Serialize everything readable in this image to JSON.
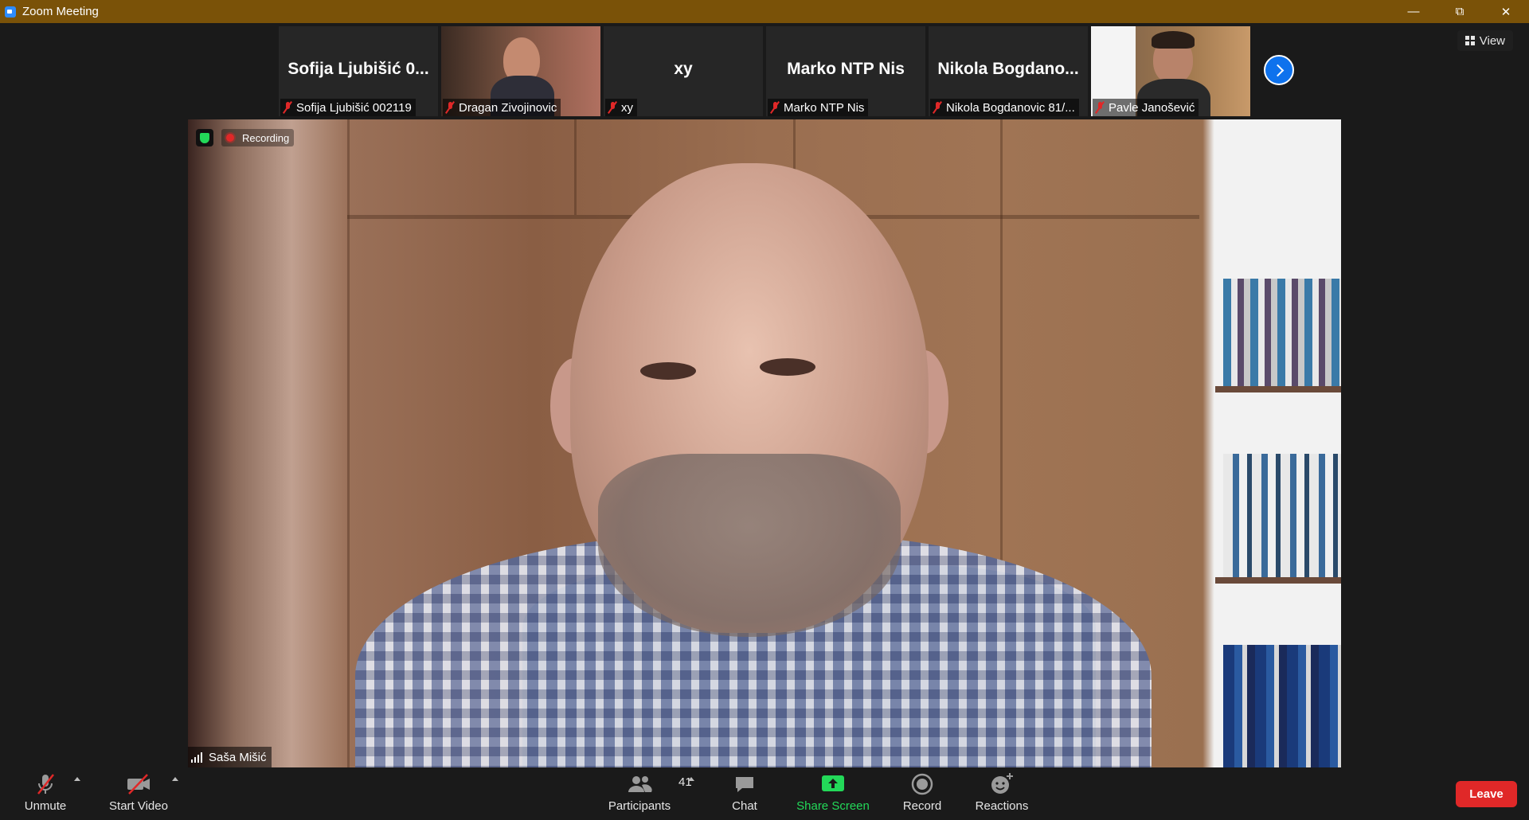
{
  "window": {
    "title": "Zoom Meeting"
  },
  "top_right": {
    "view_label": "View"
  },
  "gallery_strip": [
    {
      "display_name": "Sofija  Ljubišić  0...",
      "label": "Sofija Ljubišić 002119",
      "muted": true,
      "video": false
    },
    {
      "display_name": "",
      "label": "Dragan Zivojinovic",
      "muted": true,
      "video": true
    },
    {
      "display_name": "xy",
      "label": "xy",
      "muted": true,
      "video": false
    },
    {
      "display_name": "Marko  NTP  Nis",
      "label": "Marko NTP Nis",
      "muted": true,
      "video": false
    },
    {
      "display_name": "Nikola  Bogdano...",
      "label": "Nikola Bogdanovic 81/...",
      "muted": true,
      "video": false
    },
    {
      "display_name": "",
      "label": "Pavle Janošević",
      "muted": true,
      "video": true
    }
  ],
  "main_video": {
    "speaker_name": "Saša Mišić",
    "recording_label": "Recording"
  },
  "toolbar": {
    "unmute_label": "Unmute",
    "start_video_label": "Start Video",
    "participants_label": "Participants",
    "participants_count": "41",
    "chat_label": "Chat",
    "share_screen_label": "Share Screen",
    "record_label": "Record",
    "reactions_label": "Reactions",
    "leave_label": "Leave"
  },
  "colors": {
    "titlebar": "#7a5208",
    "share_screen": "#23d959",
    "leave": "#e02828",
    "accent": "#0e72ed"
  }
}
